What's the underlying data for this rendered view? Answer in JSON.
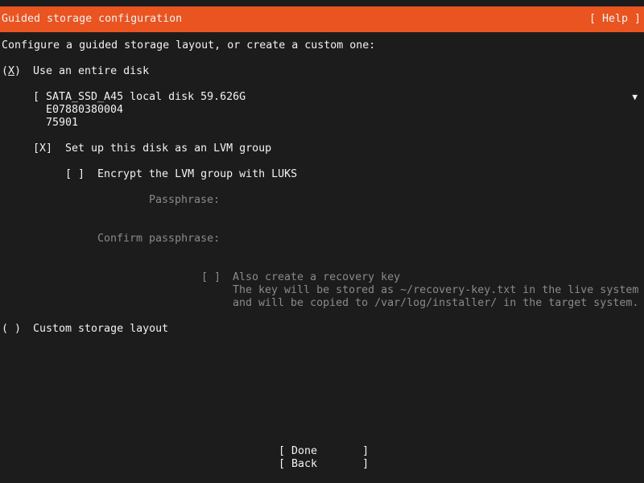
{
  "header": {
    "title": "Guided storage configuration",
    "help": "[ Help ]"
  },
  "intro": "Configure a guided storage layout, or create a custom one:",
  "entire_disk": {
    "radio_open": "(",
    "radio_mark": "X",
    "radio_close": ")",
    "label": "Use an entire disk",
    "disk_line1": "[ SATA_SSD_A45 local disk 59.626G",
    "disk_line2": "E07880380004",
    "disk_line3": "75901",
    "lvm_checkbox": "[X]",
    "lvm_label": "Set up this disk as an LVM group",
    "luks_checkbox": "[ ]",
    "luks_label": "Encrypt the LVM group with LUKS",
    "passphrase_label": "Passphrase:",
    "confirm_label": "Confirm passphrase:",
    "recovery_checkbox": "[ ]",
    "recovery_label": "Also create a recovery key",
    "recovery_note1": "The key will be stored as ~/recovery-key.txt in the live system",
    "recovery_note2": "and will be copied to /var/log/installer/ in the target system."
  },
  "custom": {
    "radio": "( )",
    "label": "Custom storage layout"
  },
  "buttons": {
    "done": "[ Done       ]",
    "back": "[ Back       ]"
  },
  "icons": {
    "disk_dropdown": "triangle-down"
  },
  "colors": {
    "header_bg": "#e95420",
    "background": "#1c1c1c",
    "text": "#f2f2f2",
    "disabled_text": "#8a8a8a"
  }
}
